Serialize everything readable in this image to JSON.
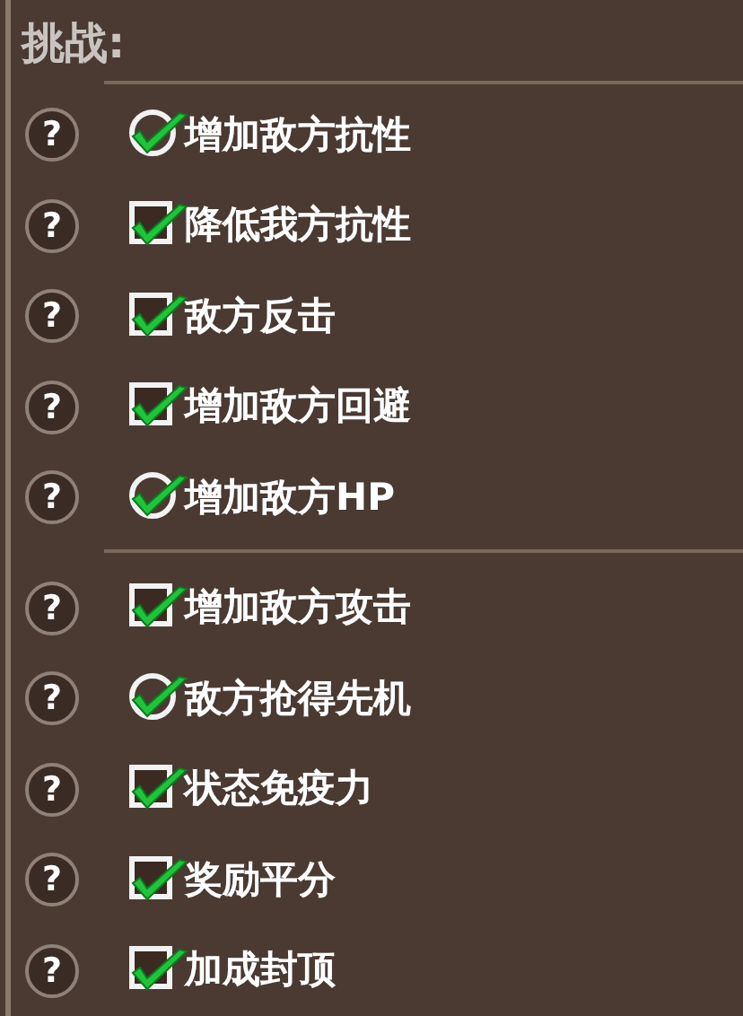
{
  "title": "挑战:",
  "groups": [
    {
      "items": [
        {
          "help": "?",
          "kind": "circle",
          "checked": true,
          "label": "增加敌方抗性"
        },
        {
          "help": "?",
          "kind": "box",
          "checked": true,
          "label": "降低我方抗性"
        },
        {
          "help": "?",
          "kind": "box",
          "checked": true,
          "label": "敌方反击"
        },
        {
          "help": "?",
          "kind": "box",
          "checked": true,
          "label": "增加敌方回避"
        },
        {
          "help": "?",
          "kind": "circle",
          "checked": true,
          "label": "增加敌方HP"
        }
      ]
    },
    {
      "items": [
        {
          "help": "?",
          "kind": "box",
          "checked": true,
          "label": "增加敌方攻击"
        },
        {
          "help": "?",
          "kind": "circle",
          "checked": true,
          "label": "敌方抢得先机"
        },
        {
          "help": "?",
          "kind": "box",
          "checked": true,
          "label": "状态免疫力"
        },
        {
          "help": "?",
          "kind": "box",
          "checked": true,
          "label": "奖励平分"
        },
        {
          "help": "?",
          "kind": "box",
          "checked": true,
          "label": "加成封顶"
        }
      ]
    }
  ]
}
